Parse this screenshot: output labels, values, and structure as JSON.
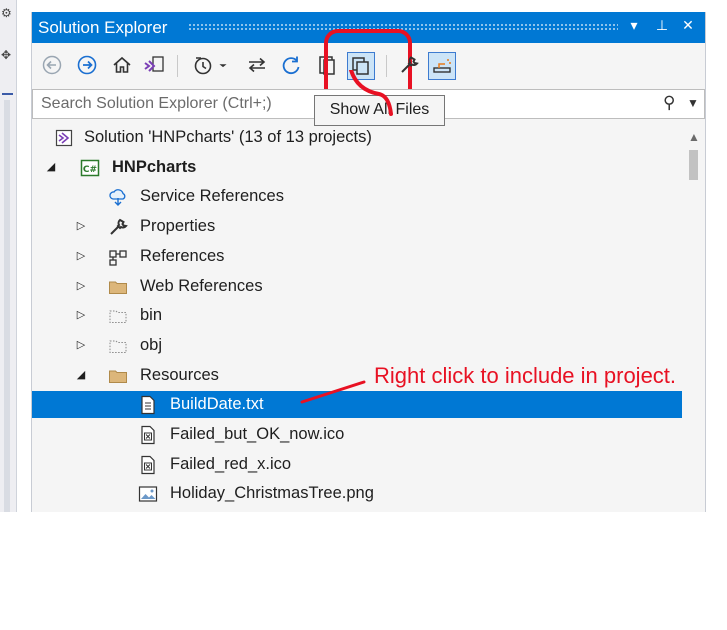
{
  "window": {
    "title": "Solution Explorer",
    "controls": {
      "dropdown": "▾",
      "pin": "⊥",
      "close": "✕"
    }
  },
  "toolbar": {
    "tools": [
      {
        "id": "back",
        "icon": "back-arrow-icon"
      },
      {
        "id": "forward",
        "icon": "forward-arrow-icon"
      },
      {
        "id": "home",
        "icon": "home-icon"
      },
      {
        "id": "switch-views",
        "icon": "vs-switch-views-icon"
      },
      {
        "id": "pending-changes",
        "icon": "clock-icon"
      },
      {
        "id": "sync",
        "icon": "sync-arrows-icon"
      },
      {
        "id": "refresh",
        "icon": "refresh-icon"
      },
      {
        "id": "collapse-all",
        "icon": "collapse-all-icon"
      },
      {
        "id": "show-all-files",
        "icon": "show-all-files-icon"
      },
      {
        "id": "properties",
        "icon": "wrench-icon"
      },
      {
        "id": "preview",
        "icon": "preview-icon"
      }
    ],
    "accent": "#e81123"
  },
  "search": {
    "placeholder": "Search Solution Explorer (Ctrl+;)"
  },
  "tooltip": {
    "text": "Show All Files"
  },
  "tree": {
    "items": [
      {
        "label": "Solution 'HNPcharts' (13 of 13 projects)",
        "icon": "solution-icon",
        "expander": ""
      },
      {
        "label": "HNPcharts",
        "icon": "csharp-project-icon",
        "expander": "◢",
        "bold": true
      },
      {
        "label": "Service References",
        "icon": "service-references-icon",
        "expander": ""
      },
      {
        "label": "Properties",
        "icon": "wrench-icon",
        "expander": "▷"
      },
      {
        "label": "References",
        "icon": "references-icon",
        "expander": "▷"
      },
      {
        "label": "Web References",
        "icon": "folder-icon",
        "expander": "▷"
      },
      {
        "label": "bin",
        "icon": "dotted-folder-icon",
        "expander": "▷"
      },
      {
        "label": "obj",
        "icon": "dotted-folder-icon",
        "expander": "▷"
      },
      {
        "label": "Resources",
        "icon": "folder-icon",
        "expander": "◢"
      },
      {
        "label": "BuildDate.txt",
        "icon": "text-file-icon",
        "expander": "",
        "selected": true
      },
      {
        "label": "Failed_but_OK_now.ico",
        "icon": "ico-file-icon",
        "expander": ""
      },
      {
        "label": "Failed_red_x.ico",
        "icon": "ico-file-icon",
        "expander": ""
      },
      {
        "label": "Holiday_ChristmasTree.png",
        "icon": "image-file-icon",
        "expander": ""
      }
    ]
  },
  "annotation": {
    "text": "Right click to include in project."
  },
  "colors": {
    "title_bar": "#0078d4",
    "selection": "#0078d4",
    "annotation": "#e81123"
  }
}
